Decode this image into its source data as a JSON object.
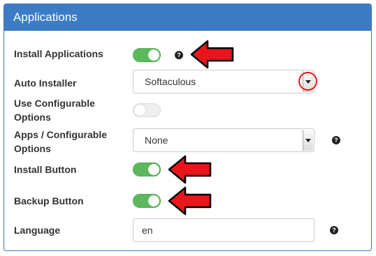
{
  "panel": {
    "title": "Applications"
  },
  "fields": {
    "install_applications": {
      "label": "Install Applications",
      "enabled": true
    },
    "auto_installer": {
      "label": "Auto Installer",
      "value": "Softaculous"
    },
    "use_configurable_options": {
      "label": "Use Configurable Options",
      "enabled": false
    },
    "apps_configurable_options": {
      "label": "Apps / Configurable Options",
      "value": "None"
    },
    "install_button": {
      "label": "Install Button",
      "enabled": true
    },
    "backup_button": {
      "label": "Backup Button",
      "enabled": true
    },
    "language": {
      "label": "Language",
      "value": "en"
    }
  },
  "icons": {
    "help": "question-circle-icon",
    "arrow": "red-arrow-left-icon",
    "highlight": "red-circle-highlight"
  },
  "help_glyph": "?",
  "colors": {
    "header": "#3b7cc4",
    "toggle_on": "#5cb85c",
    "toggle_off": "#eeeeee",
    "annotation_red": "#e8161b"
  }
}
